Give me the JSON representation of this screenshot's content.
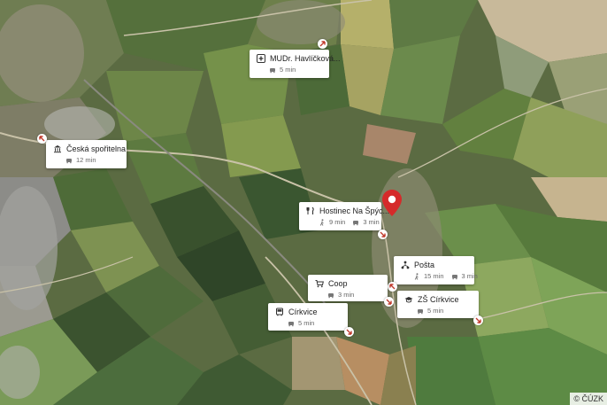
{
  "copyright": "© ČÚZK",
  "places": [
    {
      "id": "mudr",
      "name": "MUDr. Havlíčková...",
      "icon": "medical-icon",
      "walk": "",
      "car": "5 min"
    },
    {
      "id": "sporitelna",
      "name": "Česká spořitelna",
      "icon": "bank-icon",
      "walk": "",
      "car": "12 min"
    },
    {
      "id": "hostinec",
      "name": "Hostinec Na Špýc...",
      "icon": "restaurant-icon",
      "walk": "9 min",
      "car": "3 min"
    },
    {
      "id": "posta",
      "name": "Pošta",
      "icon": "post-icon",
      "walk": "15 min",
      "car": "3 min"
    },
    {
      "id": "coop",
      "name": "Coop",
      "icon": "shop-icon",
      "walk": "",
      "car": "3 min"
    },
    {
      "id": "zs",
      "name": "ZŠ Církvice",
      "icon": "school-icon",
      "walk": "",
      "car": "5 min"
    },
    {
      "id": "cirkvice",
      "name": "Církvice",
      "icon": "bus-icon",
      "walk": "",
      "car": "5 min"
    }
  ],
  "colors": {
    "pin": "#d52a2a",
    "arrow": "#c0392b"
  }
}
